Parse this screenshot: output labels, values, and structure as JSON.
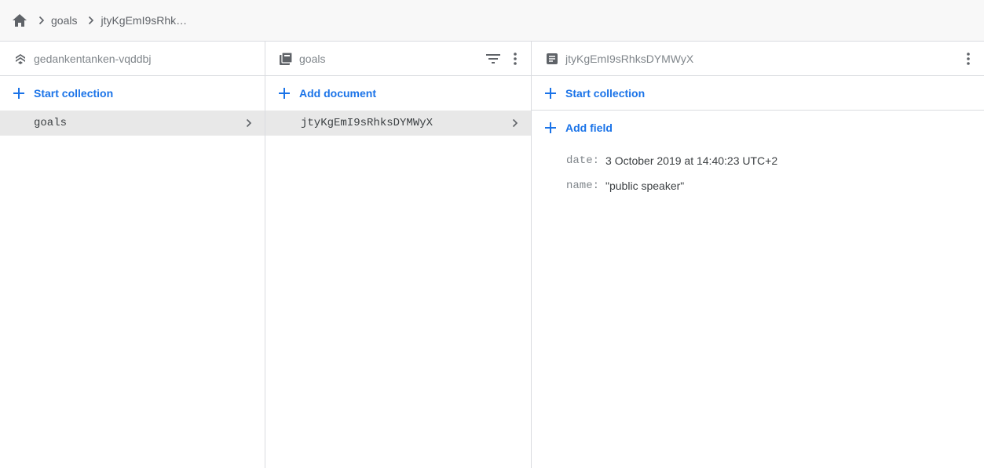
{
  "breadcrumb": {
    "home_icon": "home-icon",
    "items": [
      "goals",
      "jtyKgEmI9sRhks…"
    ]
  },
  "panel_project": {
    "icon": "firestore-stack-icon",
    "title": "gedankentanken-vqddbj",
    "action": "Start collection",
    "items": [
      {
        "label": "goals"
      }
    ]
  },
  "panel_collection": {
    "icon": "collection-icon",
    "title": "goals",
    "action": "Add document",
    "items": [
      {
        "label": "jtyKgEmI9sRhksDYMWyX"
      }
    ]
  },
  "panel_document": {
    "icon": "document-icon",
    "title": "jtyKgEmI9sRhksDYMWyX",
    "action_collection": "Start collection",
    "action_field": "Add field",
    "fields": [
      {
        "key": "date:",
        "value": "3 October 2019 at 14:40:23 UTC+2"
      },
      {
        "key": "name:",
        "value": "\"public speaker\""
      }
    ]
  },
  "colors": {
    "accent": "#1a73e8",
    "selected_row": "#e8e8e8",
    "divider": "#dadce0",
    "header_bg": "#f8f8f8"
  }
}
